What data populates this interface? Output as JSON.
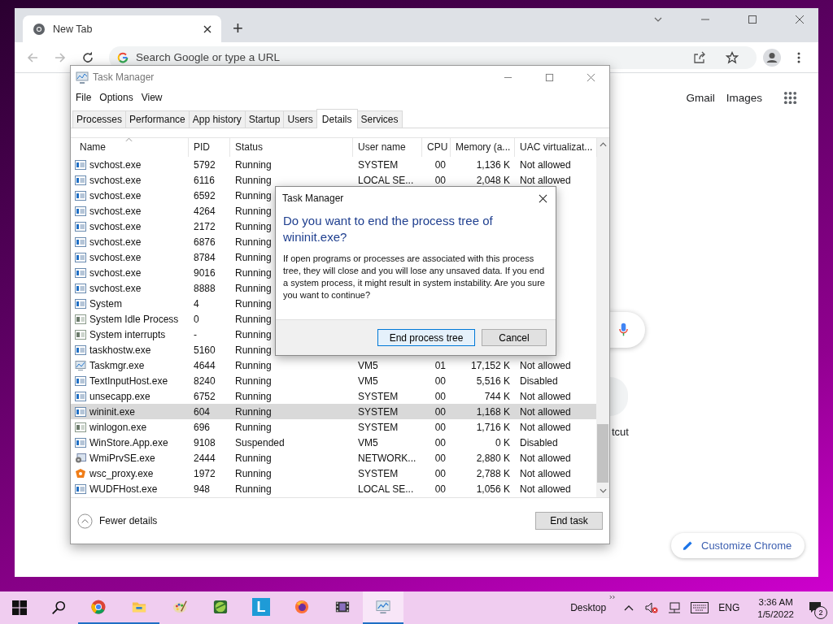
{
  "chrome": {
    "tab_title": "New Tab",
    "new_tab": "+",
    "omnibox": {
      "placeholder": "Search Google or type a URL"
    },
    "top_links": [
      "Gmail",
      "Images"
    ],
    "shortcut_label": "tcut",
    "customize_button": "Customize Chrome"
  },
  "task_manager": {
    "title": "Task Manager",
    "menu": [
      "File",
      "Options",
      "View"
    ],
    "tabs": [
      {
        "label": "Processes",
        "selected": false
      },
      {
        "label": "Performance",
        "selected": false
      },
      {
        "label": "App history",
        "selected": false
      },
      {
        "label": "Startup",
        "selected": false
      },
      {
        "label": "Users",
        "selected": false
      },
      {
        "label": "Details",
        "selected": true
      },
      {
        "label": "Services",
        "selected": false
      }
    ],
    "columns": [
      {
        "label": "Name",
        "sorted": true
      },
      {
        "label": "PID",
        "sorted": false
      },
      {
        "label": "Status",
        "sorted": false
      },
      {
        "label": "User name",
        "sorted": false
      },
      {
        "label": "CPU",
        "sorted": false
      },
      {
        "label": "Memory (a...",
        "sorted": false
      },
      {
        "label": "UAC virtualizat...",
        "sorted": false
      }
    ],
    "rows": [
      {
        "kind": "app",
        "name": "svchost.exe",
        "pid": "5792",
        "status": "Running",
        "user": "SYSTEM",
        "cpu": "00",
        "memory": "1,136 K",
        "uac": "Not allowed",
        "selected": false
      },
      {
        "kind": "app",
        "name": "svchost.exe",
        "pid": "6116",
        "status": "Running",
        "user": "LOCAL SE...",
        "cpu": "00",
        "memory": "2,048 K",
        "uac": "Not allowed",
        "selected": false
      },
      {
        "kind": "app",
        "name": "svchost.exe",
        "pid": "6592",
        "status": "Running",
        "selected": false
      },
      {
        "kind": "app",
        "name": "svchost.exe",
        "pid": "4264",
        "status": "Running",
        "selected": false
      },
      {
        "kind": "app",
        "name": "svchost.exe",
        "pid": "2172",
        "status": "Running",
        "selected": false
      },
      {
        "kind": "app",
        "name": "svchost.exe",
        "pid": "6876",
        "status": "Running",
        "selected": false
      },
      {
        "kind": "app",
        "name": "svchost.exe",
        "pid": "8784",
        "status": "Running",
        "selected": false
      },
      {
        "kind": "app",
        "name": "svchost.exe",
        "pid": "9016",
        "status": "Running",
        "selected": false
      },
      {
        "kind": "app",
        "name": "svchost.exe",
        "pid": "8888",
        "status": "Running",
        "selected": false
      },
      {
        "kind": "app",
        "name": "System",
        "pid": "4",
        "status": "Running",
        "selected": false
      },
      {
        "kind": "system",
        "name": "System Idle Process",
        "pid": "0",
        "status": "Running",
        "selected": false
      },
      {
        "kind": "system",
        "name": "System interrupts",
        "pid": "-",
        "status": "Running",
        "selected": false
      },
      {
        "kind": "app",
        "name": "taskhostw.exe",
        "pid": "5160",
        "status": "Running",
        "selected": false
      },
      {
        "kind": "taskmgr",
        "name": "Taskmgr.exe",
        "pid": "4644",
        "status": "Running",
        "user": "VM5",
        "cpu": "01",
        "memory": "17,152 K",
        "uac": "Not allowed",
        "selected": false
      },
      {
        "kind": "app",
        "name": "TextInputHost.exe",
        "pid": "8240",
        "status": "Running",
        "user": "VM5",
        "cpu": "00",
        "memory": "5,516 K",
        "uac": "Disabled",
        "selected": false
      },
      {
        "kind": "app",
        "name": "unsecapp.exe",
        "pid": "6752",
        "status": "Running",
        "user": "SYSTEM",
        "cpu": "00",
        "memory": "744 K",
        "uac": "Not allowed",
        "selected": false
      },
      {
        "kind": "app",
        "name": "wininit.exe",
        "pid": "604",
        "status": "Running",
        "user": "SYSTEM",
        "cpu": "00",
        "memory": "1,168 K",
        "uac": "Not allowed",
        "selected": true
      },
      {
        "kind": "system",
        "name": "winlogon.exe",
        "pid": "696",
        "status": "Running",
        "user": "SYSTEM",
        "cpu": "00",
        "memory": "1,716 K",
        "uac": "Not allowed",
        "selected": false
      },
      {
        "kind": "app",
        "name": "WinStore.App.exe",
        "pid": "9108",
        "status": "Suspended",
        "user": "VM5",
        "cpu": "00",
        "memory": "0 K",
        "uac": "Disabled",
        "selected": false
      },
      {
        "kind": "wmi",
        "name": "WmiPrvSE.exe",
        "pid": "2444",
        "status": "Running",
        "user": "NETWORK...",
        "cpu": "00",
        "memory": "2,880 K",
        "uac": "Not allowed",
        "selected": false
      },
      {
        "kind": "shield",
        "name": "wsc_proxy.exe",
        "pid": "1972",
        "status": "Running",
        "user": "SYSTEM",
        "cpu": "00",
        "memory": "2,788 K",
        "uac": "Not allowed",
        "selected": false
      },
      {
        "kind": "app",
        "name": "WUDFHost.exe",
        "pid": "948",
        "status": "Running",
        "user": "LOCAL SE...",
        "cpu": "00",
        "memory": "1,056 K",
        "uac": "Not allowed",
        "selected": false
      }
    ],
    "footer": {
      "fewer_details": "Fewer details",
      "end_task": "End task"
    }
  },
  "dialog": {
    "title": "Task Manager",
    "heading": "Do you want to end the process tree of wininit.exe?",
    "body": "If open programs or processes are associated with this process tree, they will close and you will lose any unsaved data. If you end a system process, it might result in system instability. Are you sure you want to continue?",
    "buttons": [
      {
        "label": "End process tree",
        "default": true
      },
      {
        "label": "Cancel",
        "default": false
      }
    ]
  },
  "taskbar": {
    "apps": [
      {
        "kind": "chrome",
        "running": true,
        "active": false
      },
      {
        "kind": "folder",
        "running": true,
        "active": false
      },
      {
        "kind": "paint",
        "running": false,
        "active": false
      },
      {
        "kind": "globe",
        "running": false,
        "active": false
      },
      {
        "kind": "letter",
        "label": "L",
        "running": false,
        "active": false
      },
      {
        "kind": "firefox",
        "running": false,
        "active": false
      },
      {
        "kind": "film",
        "running": false,
        "active": false
      },
      {
        "kind": "taskmgr",
        "running": true,
        "active": true
      }
    ],
    "desktop_label": "Desktop",
    "language": "ENG",
    "time": "3:36 AM",
    "date": "1/5/2022",
    "notification_count": "2"
  }
}
